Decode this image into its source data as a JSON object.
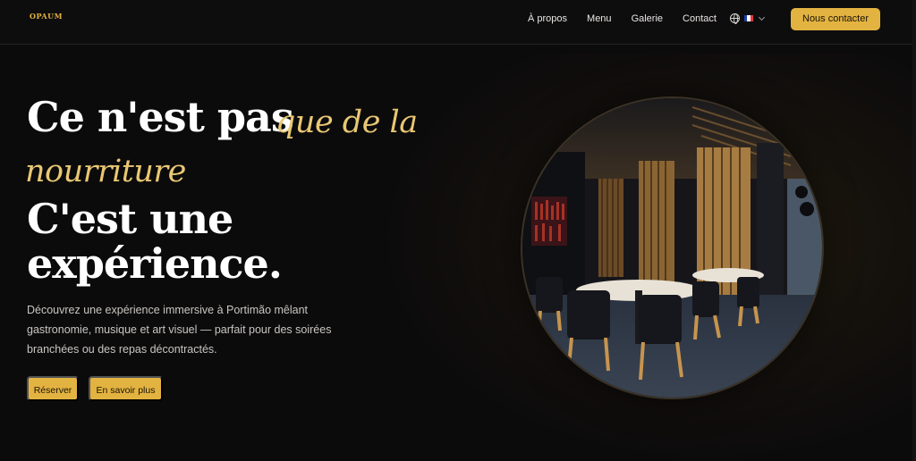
{
  "nav": {
    "logo_text": "OPAUM",
    "links": [
      "À propos",
      "Menu",
      "Galerie",
      "Contact"
    ],
    "language_icon": "globe-icon",
    "flag_colors": [
      "#1f3ea8",
      "#ffffff",
      "#e63a3a"
    ],
    "cta_label": "Nous contacter"
  },
  "hero": {
    "line1": "Ce n'est pas",
    "script1": "que de la",
    "script2": "nourriture",
    "line3": "C'est une",
    "line4": "expérience.",
    "description": "Découvrez une expérience immersive à Portimão mêlant gastronomie, musique et art visuel — parfait pour des soirées branchées ou des repas décontractés.",
    "buttons": [
      "Réserver",
      "En savoir plus"
    ]
  },
  "colors": {
    "accent": "#e3b341",
    "script": "#e9c873",
    "background": "#0c0b0c"
  }
}
